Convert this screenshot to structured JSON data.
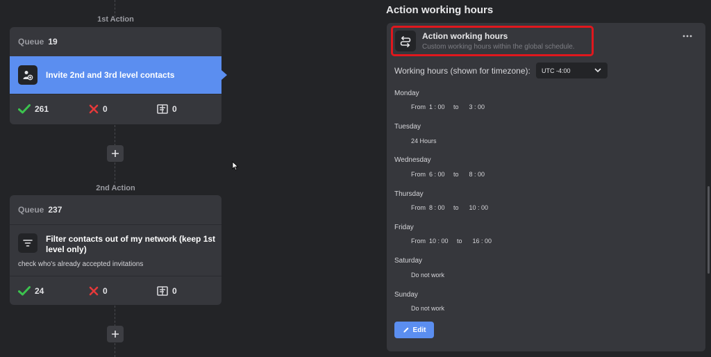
{
  "workflow": {
    "steps": [
      {
        "label": "1st Action",
        "queue_label": "Queue",
        "queue_count": "19",
        "action_title": "Invite 2nd and 3rd level contacts",
        "stats": {
          "success": "261",
          "failed": "0",
          "skipped": "0"
        }
      },
      {
        "label": "2nd Action",
        "queue_label": "Queue",
        "queue_count": "237",
        "action_title": "Filter contacts out of my network (keep 1st level only)",
        "action_note": "check who's already accepted invitations",
        "stats": {
          "success": "24",
          "failed": "0",
          "skipped": "0"
        }
      }
    ],
    "add_icon": "plus-icon"
  },
  "panel": {
    "section_title": "Action working hours",
    "header_title": "Action working hours",
    "header_subtitle": "Custom working hours within the global schedule.",
    "timezone_label": "Working hours (shown for timezone):",
    "timezone_value": "UTC -4:00",
    "days": [
      {
        "name": "Monday",
        "hours": "From  1 : 00     to      3 : 00"
      },
      {
        "name": "Tuesday",
        "hours": "24 Hours"
      },
      {
        "name": "Wednesday",
        "hours": "From  6 : 00     to      8 : 00"
      },
      {
        "name": "Thursday",
        "hours": "From  8 : 00     to      10 : 00"
      },
      {
        "name": "Friday",
        "hours": "From  10 : 00     to      16 : 00"
      },
      {
        "name": "Saturday",
        "hours": "Do not work"
      },
      {
        "name": "Sunday",
        "hours": "Do not work"
      }
    ],
    "edit_label": "Edit"
  },
  "colors": {
    "accent": "#5b8ef0",
    "success": "#3cc34e",
    "error": "#e5393a",
    "highlight": "#e0171d",
    "background": "#232427",
    "card": "#36373c"
  }
}
